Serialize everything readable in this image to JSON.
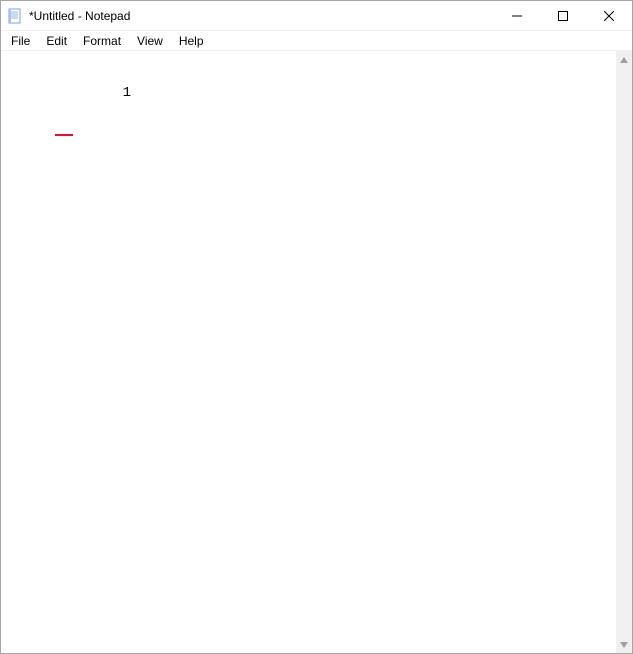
{
  "window": {
    "title": "*Untitled - Notepad"
  },
  "menubar": {
    "file": "File",
    "edit": "Edit",
    "format": "Format",
    "view": "View",
    "help": "Help"
  },
  "editor": {
    "content": "1"
  }
}
